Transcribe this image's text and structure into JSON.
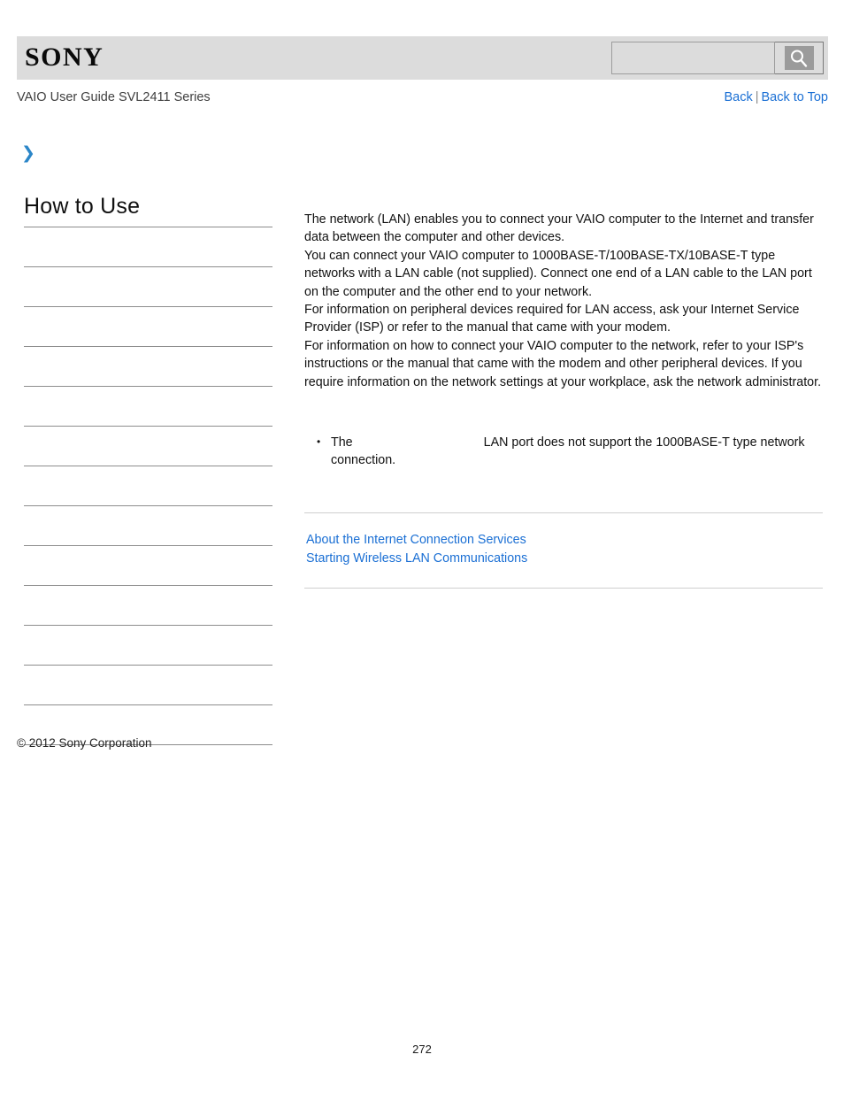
{
  "header": {
    "logo_text": "SONY",
    "search": {
      "value": "",
      "placeholder": "",
      "icon": "search-icon",
      "button_label": ""
    },
    "guide_title": "VAIO User Guide SVL2411 Series",
    "links": {
      "back": "Back",
      "separator": "|",
      "back_to_top": "Back to Top"
    }
  },
  "breadcrumb": {
    "chevron_icon": "chevron-right-icon",
    "text": ""
  },
  "sidebar": {
    "title": "How to Use",
    "items": [
      {
        "label": ""
      },
      {
        "label": ""
      },
      {
        "label": ""
      },
      {
        "label": ""
      },
      {
        "label": ""
      },
      {
        "label": ""
      },
      {
        "label": ""
      },
      {
        "label": ""
      },
      {
        "label": ""
      },
      {
        "label": ""
      },
      {
        "label": ""
      },
      {
        "label": ""
      },
      {
        "label": ""
      }
    ]
  },
  "content": {
    "paragraphs": [
      "The network (LAN) enables you to connect your VAIO computer to the Internet and transfer data between the computer and other devices.",
      "You can connect your VAIO computer to 1000BASE-T/100BASE-TX/10BASE-T type networks with a LAN cable (not supplied). Connect one end of a LAN cable to the LAN port on the computer and the other end to your network.",
      "For information on peripheral devices required for LAN access, ask your Internet Service Provider (ISP) or refer to the manual that came with your modem.",
      "For information on how to connect your VAIO computer to the network, refer to your ISP's instructions or the manual that came with the modem and other peripheral devices. If you require information on the network settings at your workplace, ask the network administrator."
    ],
    "notes": [
      {
        "prefix": "The",
        "missing_term": "",
        "suffix": "LAN port does not support the 1000BASE-T type network connection."
      }
    ],
    "related_links": [
      "About the Internet Connection Services",
      "Starting Wireless LAN Communications"
    ]
  },
  "footer": {
    "copyright": "© 2012 Sony Corporation",
    "page_number": "272"
  },
  "colors": {
    "banner_bg": "#dcdcdc",
    "link_blue": "#1a6fd4",
    "chevron_blue": "#2b86c8",
    "rule_gray": "#8d8d8d",
    "content_rule_gray": "#cfcfcf"
  }
}
